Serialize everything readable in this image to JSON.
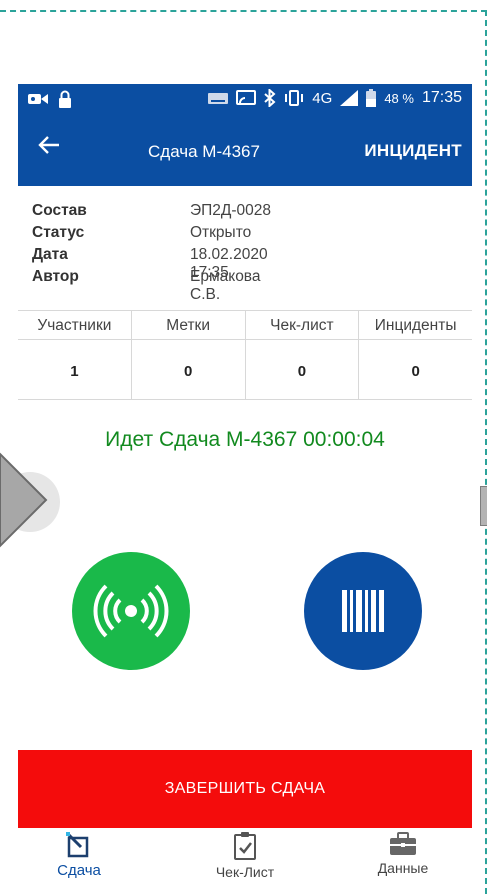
{
  "statusbar": {
    "network": "4G",
    "battery_percent": "48 %",
    "time": "17:35",
    "icons": [
      "video-icon",
      "lock-icon",
      "keyboard-icon",
      "cast-icon",
      "bluetooth-icon",
      "vibrate-icon",
      "signal-icon",
      "battery-icon"
    ]
  },
  "appbar": {
    "back_icon": "arrow-left-icon",
    "title": "Сдача М-4367",
    "action_label": "ИНЦИДЕНТ"
  },
  "info": {
    "rows": [
      {
        "label": "Состав",
        "value": "ЭП2Д-0028"
      },
      {
        "label": "Статус",
        "value": "Открыто"
      },
      {
        "label": "Дата",
        "value": "18.02.2020 17:35"
      },
      {
        "label": "Автор",
        "value": "Ермакова С.В."
      }
    ]
  },
  "counters": [
    {
      "label": "Участники",
      "value": "1"
    },
    {
      "label": "Метки",
      "value": "0"
    },
    {
      "label": "Чек-лист",
      "value": "0"
    },
    {
      "label": "Инциденты",
      "value": "0"
    }
  ],
  "running_text": "Идет Сдача М-4367 00:00:04",
  "buttons": {
    "nfc_icon": "nfc-scan-icon",
    "barcode_icon": "barcode-icon",
    "nfc_color": "#1ab94a",
    "barcode_color": "#0b4ea2"
  },
  "finish_label": "ЗАВЕРШИТЬ СДАЧА",
  "bottom_nav": [
    {
      "label": "Сдача",
      "icon": "edit-icon",
      "active": true
    },
    {
      "label": "Чек-Лист",
      "icon": "clipboard-check-icon",
      "active": false
    },
    {
      "label": "Данные",
      "icon": "briefcase-icon",
      "active": false
    }
  ],
  "colors": {
    "primary": "#0b4ea2",
    "success": "#128a1f",
    "danger": "#f40c0c"
  }
}
